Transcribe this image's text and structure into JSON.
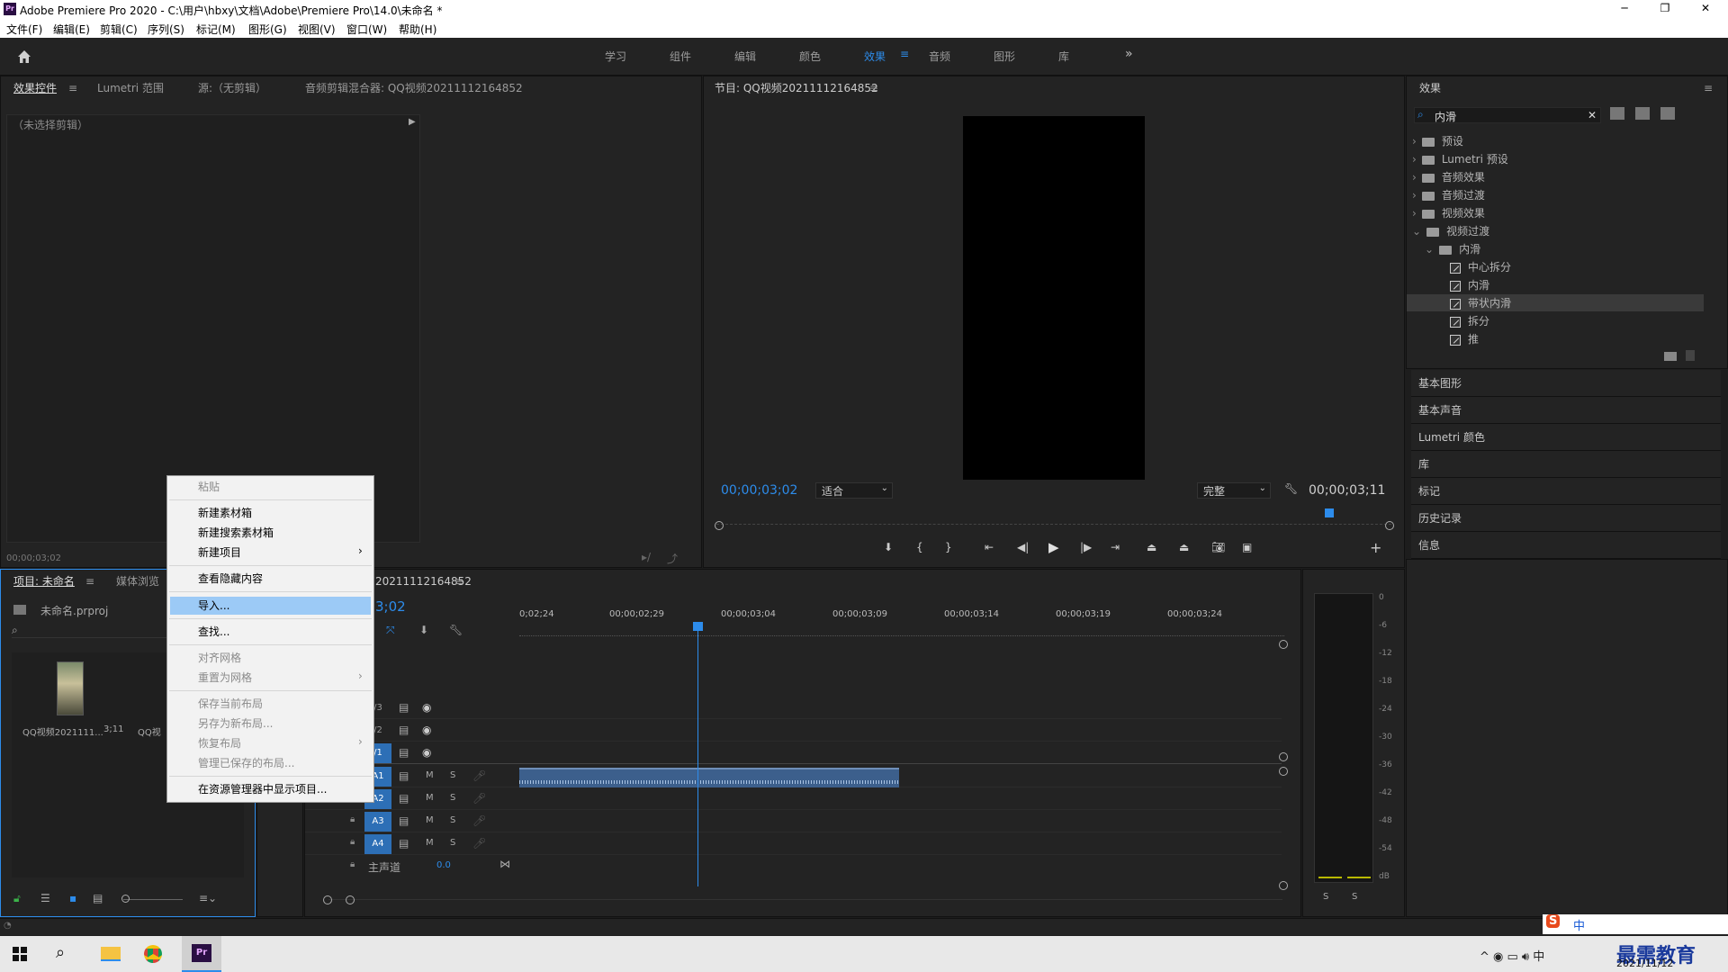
{
  "window": {
    "title": "Adobe Premiere Pro 2020 - C:\\用户\\hbxy\\文档\\Adobe\\Premiere Pro\\14.0\\未命名 *",
    "min": "─",
    "max": "❐",
    "close": "✕"
  },
  "menu": [
    "文件(F)",
    "编辑(E)",
    "剪辑(C)",
    "序列(S)",
    "标记(M)",
    "图形(G)",
    "视图(V)",
    "窗口(W)",
    "帮助(H)"
  ],
  "workspaces": [
    "学习",
    "组件",
    "编辑",
    "颜色",
    "效果",
    "音频",
    "图形",
    "库"
  ],
  "active_workspace": "效果",
  "source_panel": {
    "tabs": [
      "效果控件",
      "Lumetri 范围",
      "源:（无剪辑）",
      "音频剪辑混合器: QQ视频20211112164852"
    ],
    "empty_clip": "（未选择剪辑）",
    "timecode": "00;00;03;02"
  },
  "program": {
    "title": "节目: QQ视频20211112164852",
    "timecode": "00;00;03;02",
    "fit": "适合",
    "quality": "完整",
    "duration": "00;00;03;11"
  },
  "effects_panel": {
    "title": "效果",
    "search": "内滑",
    "tree": [
      {
        "label": "预设",
        "type": "folder",
        "level": 0
      },
      {
        "label": "Lumetri 预设",
        "type": "folder",
        "level": 0
      },
      {
        "label": "音频效果",
        "type": "folder",
        "level": 0
      },
      {
        "label": "音频过渡",
        "type": "folder",
        "level": 0
      },
      {
        "label": "视频效果",
        "type": "folder",
        "level": 0
      },
      {
        "label": "视频过渡",
        "type": "folder",
        "level": 0,
        "open": true
      },
      {
        "label": "内滑",
        "type": "folder",
        "level": 1,
        "open": true
      },
      {
        "label": "中心拆分",
        "type": "effect",
        "level": 2
      },
      {
        "label": "内滑",
        "type": "effect",
        "level": 2
      },
      {
        "label": "带状内滑",
        "type": "effect",
        "level": 2,
        "selected": true
      },
      {
        "label": "拆分",
        "type": "effect",
        "level": 2
      },
      {
        "label": "推",
        "type": "effect",
        "level": 2
      }
    ]
  },
  "side_panels": [
    "基本图形",
    "基本声音",
    "Lumetri 颜色",
    "库",
    "标记",
    "历史记录",
    "信息"
  ],
  "project": {
    "tabs": [
      "项目: 未命名",
      "媒体浏览"
    ],
    "file": "未命名.prproj",
    "clip_name": "QQ视频2021111...",
    "clip_dur": "3;11",
    "clip2": "QQ视"
  },
  "context_menu": [
    {
      "label": "粘贴",
      "disabled": true
    },
    {
      "sep": true
    },
    {
      "label": "新建素材箱"
    },
    {
      "label": "新建搜索素材箱"
    },
    {
      "label": "新建项目",
      "sub": true
    },
    {
      "sep": true
    },
    {
      "label": "查看隐藏内容"
    },
    {
      "sep": true
    },
    {
      "label": "导入...",
      "hover": true
    },
    {
      "sep": true
    },
    {
      "label": "查找..."
    },
    {
      "sep": true
    },
    {
      "label": "对齐网格",
      "disabled": true
    },
    {
      "label": "重置为网格",
      "disabled": true,
      "sub": true
    },
    {
      "sep": true
    },
    {
      "label": "保存当前布局",
      "disabled": true
    },
    {
      "label": "另存为新布局...",
      "disabled": true
    },
    {
      "label": "恢复布局",
      "disabled": true,
      "sub": true
    },
    {
      "label": "管理已保存的布局...",
      "disabled": true
    },
    {
      "sep": true
    },
    {
      "label": "在资源管理器中显示项目..."
    }
  ],
  "timeline": {
    "title": "20211112164852",
    "timecode": "3;02",
    "ruler": [
      "0;02;24",
      "00;00;02;29",
      "00;00;03;04",
      "00;00;03;09",
      "00;00;03;14",
      "00;00;03;19",
      "00;00;03;24"
    ],
    "video_tracks": [
      "/3",
      "/2",
      "/1"
    ],
    "audio_tracks": [
      "A1",
      "A2",
      "A3",
      "A4"
    ],
    "master": "主声道",
    "master_val": "0.0"
  },
  "meter": {
    "scale": [
      "0",
      "-6",
      "-12",
      "-18",
      "-24",
      "-30",
      "-36",
      "-42",
      "-48",
      "-54",
      "dB"
    ],
    "s": "S"
  },
  "taskbar": {
    "date": "2021/11/12",
    "watermark": "最需教育",
    "ime": "中"
  }
}
